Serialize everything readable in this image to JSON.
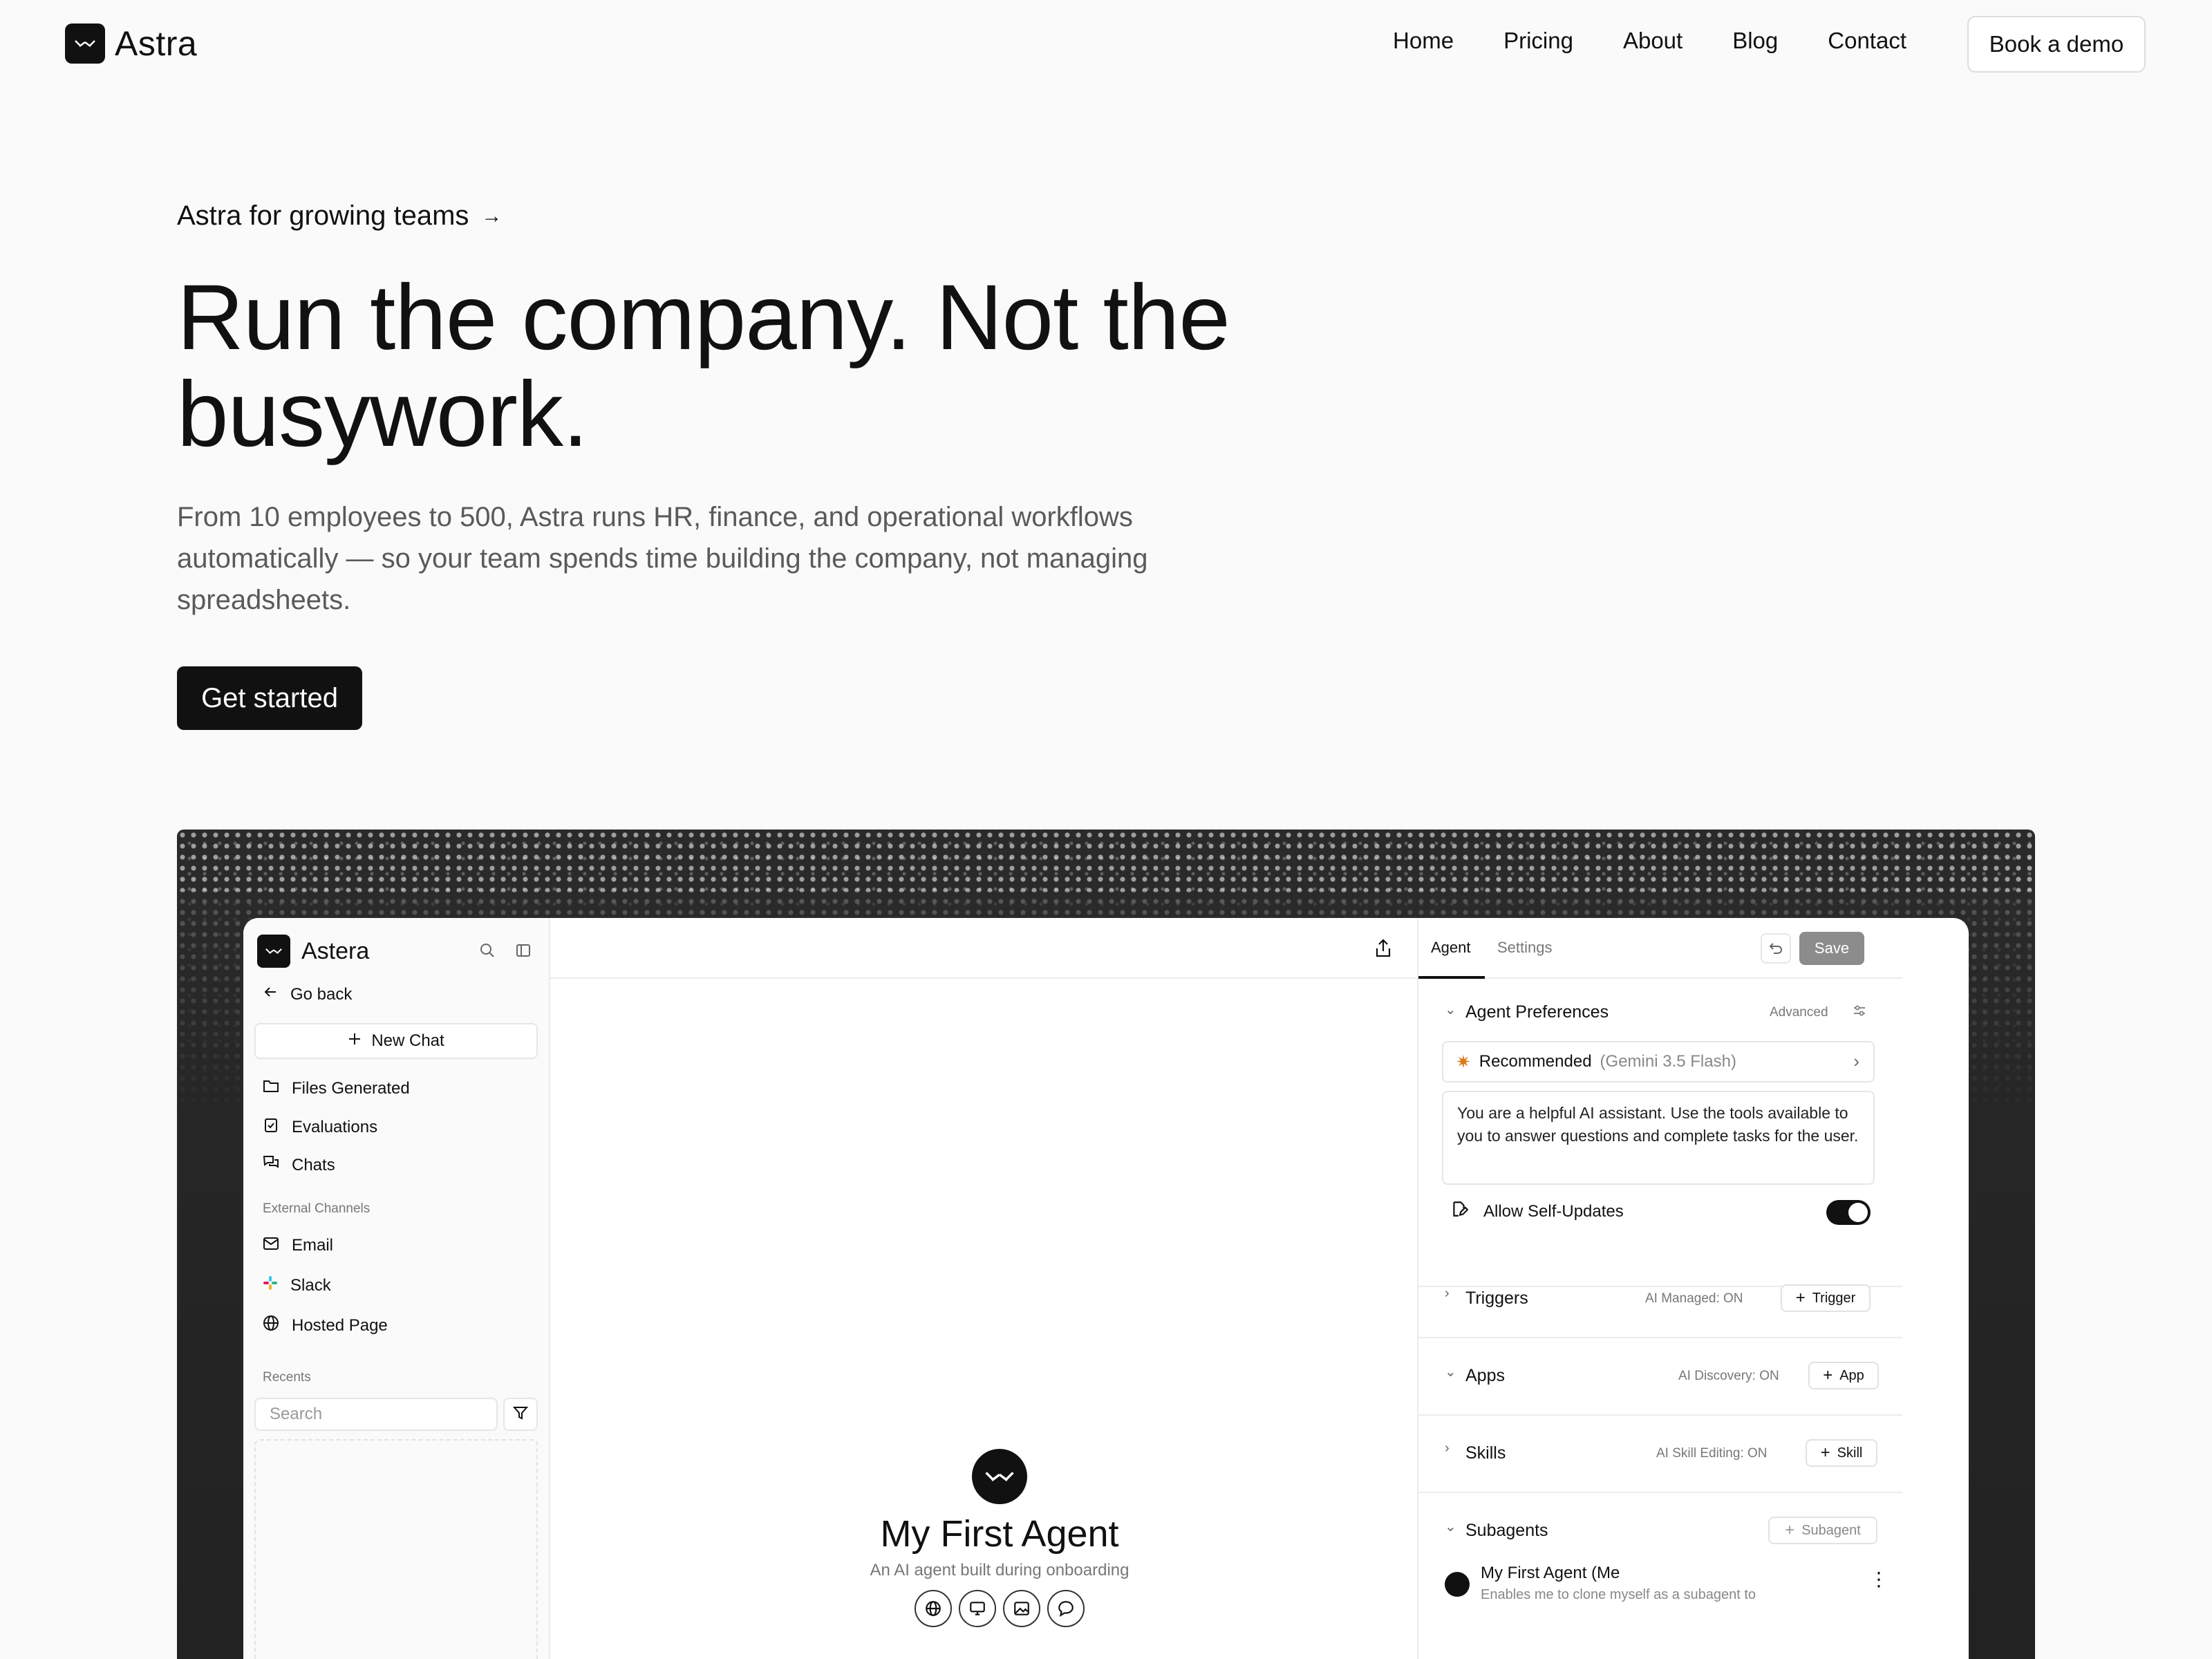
{
  "nav": {
    "brand": "Astra",
    "links": [
      "Home",
      "Pricing",
      "About",
      "Blog",
      "Contact"
    ],
    "demo_label": "Book a demo"
  },
  "hero": {
    "eyebrow": "Astra for growing teams",
    "eyebrow_arrow": "→",
    "title": "Run the company. Not the busywork.",
    "subtitle": "From 10 employees to 500, Astra runs HR, finance, and operational workflows automatically — so your team spends time building the company, not managing spreadsheets.",
    "cta": "Get started"
  },
  "app": {
    "sidebar": {
      "brand": "Astera",
      "back": "Go back",
      "new_chat": "New Chat",
      "items": [
        "Files Generated",
        "Evaluations",
        "Chats"
      ],
      "channels_label": "External Channels",
      "channels": [
        "Email",
        "Slack",
        "Hosted Page"
      ],
      "recents_label": "Recents",
      "search_placeholder": "Search"
    },
    "center": {
      "agent_title": "My First Agent",
      "agent_desc": "An AI agent built during onboarding"
    },
    "panel": {
      "tabs": [
        "Agent",
        "Settings"
      ],
      "save": "Save",
      "prefs_title": "Agent Preferences",
      "advanced": "Advanced",
      "model_main": "Recommended",
      "model_sub": "(Gemini 3.5 Flash)",
      "prompt": "You are a helpful AI assistant. Use the tools available to you to answer questions and complete tasks for the user.",
      "self_updates": "Allow Self-Updates",
      "self_updates_on": true,
      "triggers": {
        "title": "Triggers",
        "meta": "AI Managed: ON",
        "btn": "Trigger"
      },
      "apps": {
        "title": "Apps",
        "meta": "AI Discovery: ON",
        "btn": "App"
      },
      "skills": {
        "title": "Skills",
        "meta": "AI Skill Editing: ON",
        "btn": "Skill"
      },
      "subagents": {
        "title": "Subagents",
        "btn": "Subagent"
      },
      "subagent_item": {
        "name": "My First Agent (Me",
        "desc": "Enables me to clone myself as a subagent to"
      }
    }
  },
  "icons": {
    "logo": "astra-logo-icon",
    "arrow": "arrow-right-icon"
  }
}
